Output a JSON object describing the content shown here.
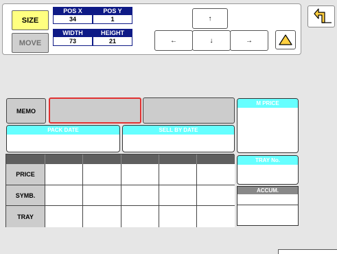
{
  "controls": {
    "size_label": "SIZE",
    "move_label": "MOVE",
    "pos_x_label": "POS X",
    "pos_x_value": "34",
    "pos_y_label": "POS Y",
    "pos_y_value": "1",
    "width_label": "WIDTH",
    "width_value": "73",
    "height_label": "HEIGHT",
    "height_value": "21",
    "arrow_up": "↑",
    "arrow_left": "←",
    "arrow_down": "↓",
    "arrow_right": "→"
  },
  "fields": {
    "memo_label": "MEMO",
    "pack_date_label": "PACK DATE",
    "sell_by_date_label": "SELL BY DATE",
    "m_price_label": "M PRICE",
    "tray_no_label": "TRAY No.",
    "accum_label": "ACCUM."
  },
  "grid": {
    "rows": [
      "PRICE",
      "SYMB.",
      "TRAY"
    ]
  },
  "colors": {
    "accent_header": "#0e1a86",
    "size_active": "#ffff80",
    "field_header": "#66ffff",
    "selected_border": "#e03030",
    "warning_fill": "#ffd040"
  }
}
